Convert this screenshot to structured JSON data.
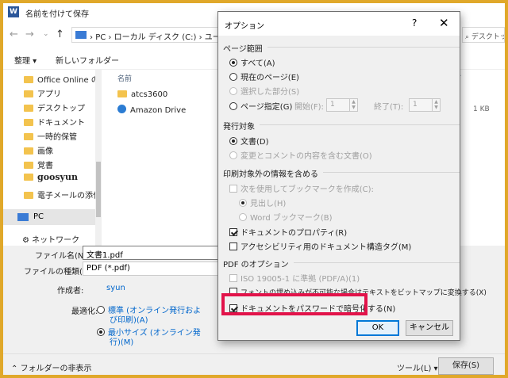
{
  "colors": {
    "frame": "#e0a82a",
    "highlight": "#e2134a",
    "accent": "#0078d7",
    "link": "#0066cc"
  },
  "save_dialog": {
    "title": "名前を付けて保存",
    "address": {
      "parts": [
        "PC",
        "ローカル ディスク (C:)",
        "ユーザー"
      ]
    },
    "search_placeholder": "デスクトップの",
    "commands": {
      "organize": "整理 ▾",
      "new_folder": "新しいフォルダー"
    },
    "nav_items": [
      "Office Online の",
      "アプリ",
      "デスクトップ",
      "ドキュメント",
      "一時的保管",
      "画像",
      "覚書",
      "goosyun",
      "電子メールの添付"
    ],
    "nav_pc": "PC",
    "nav_network": "ネットワーク",
    "columns": {
      "name": "名前",
      "size": "ズ"
    },
    "files": [
      {
        "name": "atcs3600",
        "icon": "folder-icon"
      },
      {
        "name": "Amazon Drive",
        "icon": "amazon-drive-icon"
      }
    ],
    "file_size": "1 KB",
    "form": {
      "filename_label": "ファイル名(N):",
      "filename_value": "文書1.pdf",
      "filetype_label": "ファイルの種類(T):",
      "filetype_value": "PDF (*.pdf)",
      "author_label": "作成者:",
      "author_value": "syun",
      "optimize_label": "最適化:",
      "opt_standard": "標準 (オンライン発行およ",
      "opt_standard2": "び印刷)(A)",
      "opt_min": "最小サイズ (オンライン発",
      "opt_min2": "行)(M)"
    },
    "hide_folders": "フォルダーの非表示",
    "tools": "ツール(L)",
    "save": "保存(S)"
  },
  "options": {
    "title": "オプション",
    "help": "?",
    "close": "✕",
    "page_range": {
      "heading": "ページ範囲",
      "all": "すべて(A)",
      "current": "現在のページ(E)",
      "selection": "選択した部分(S)",
      "pages": "ページ指定(G)",
      "start_label": "開始(F):",
      "start_value": "1",
      "end_label": "終了(T):",
      "end_value": "1"
    },
    "publish": {
      "heading": "発行対象",
      "document": "文書(D)",
      "markup": "変更とコメントの内容を含む文書(O)"
    },
    "nonprint": {
      "heading": "印刷対象外の情報を含める",
      "bookmarks": "次を使用してブックマークを作成(C):",
      "headings": "見出し(H)",
      "word_bookmarks": "Word ブックマーク(B)",
      "properties": "ドキュメントのプロパティ(R)",
      "structure": "アクセシビリティ用のドキュメント構造タグ(M)"
    },
    "pdf": {
      "heading": "PDF のオプション",
      "iso": "ISO 19005-1 に準拠 (PDF/A)(1)",
      "bitmap": "フォントの埋め込みが不可能な場合はテキストをビットマップに変換する(X)",
      "encrypt": "ドキュメントをパスワードで暗号化する(N)"
    },
    "ok": "OK",
    "cancel": "キャンセル"
  }
}
